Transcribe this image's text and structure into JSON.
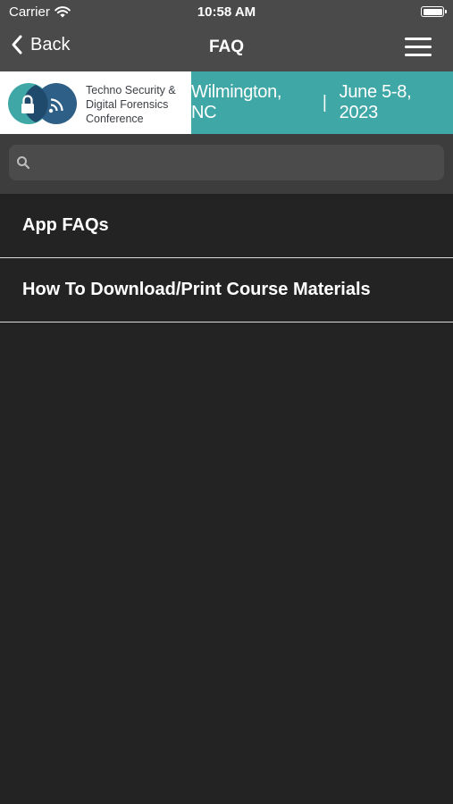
{
  "status_bar": {
    "carrier": "Carrier",
    "time": "10:58 AM"
  },
  "nav": {
    "back_label": "Back",
    "title": "FAQ"
  },
  "banner": {
    "logo_line1": "Techno Security &",
    "logo_line2": "Digital Forensics",
    "logo_line3": "Conference",
    "location": "Wilmington, NC",
    "separator": "|",
    "dates": "June 5-8, 2023",
    "accent_color": "#3fa7a6"
  },
  "search": {
    "placeholder": ""
  },
  "faq_items": [
    {
      "label": "App FAQs"
    },
    {
      "label": "How To Download/Print Course Materials"
    }
  ]
}
